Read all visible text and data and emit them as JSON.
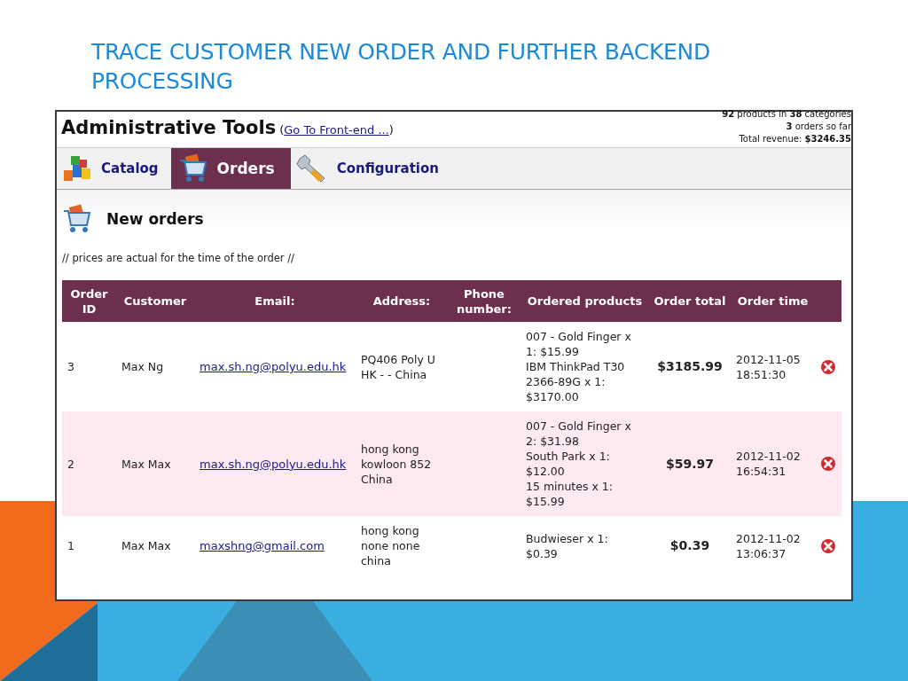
{
  "slide_title": "TRACE CUSTOMER NEW ORDER AND FURTHER BACKEND PROCESSING",
  "app": {
    "title": "Administrative Tools",
    "front_end_link": "Go To Front-end ...",
    "link_open": "(",
    "link_close": ")",
    "stats": [
      "**92** products in **38** categories",
      "**3** orders so far",
      "Total revenue: **$3246.35**"
    ]
  },
  "tabs": [
    {
      "label": "Catalog",
      "kind": "blocks",
      "selected": false
    },
    {
      "label": "Orders",
      "kind": "cart",
      "selected": true
    },
    {
      "label": "Configuration",
      "kind": "wrench",
      "selected": false
    }
  ],
  "section": {
    "title": "New orders",
    "note": "// prices are actual for the time of the order //"
  },
  "table": {
    "columns": [
      "Order ID",
      "Customer",
      "Email:",
      "Address:",
      "Phone number:",
      "Ordered products",
      "Order total",
      "Order time"
    ],
    "rows": [
      {
        "id": "3",
        "customer": "Max Ng",
        "email": "max.sh.ng@polyu.edu.hk",
        "address": "PQ406 Poly U HK - - China",
        "products": [
          "007 - Gold Finger x 1: $15.99",
          "IBM ThinkPad T30 2366-89G x 1: $3170.00"
        ],
        "total": "$3185.99",
        "time": "2012-11-05 18:51:30"
      },
      {
        "id": "2",
        "customer": "Max Max",
        "email": "max.sh.ng@polyu.edu.hk",
        "address": "hong kong kowloon 852 China",
        "products": [
          "007 - Gold Finger x 2: $31.98",
          "South Park x 1: $12.00",
          "15 minutes x 1: $15.99"
        ],
        "total": "$59.97",
        "time": "2012-11-02 16:54:31"
      },
      {
        "id": "1",
        "customer": "Max Max",
        "email": "maxshng@gmail.com",
        "address": "hong kong none none china",
        "products": [
          "Budwieser x 1: $0.39"
        ],
        "total": "$0.39",
        "time": "2012-11-02 13:06:37"
      }
    ]
  }
}
